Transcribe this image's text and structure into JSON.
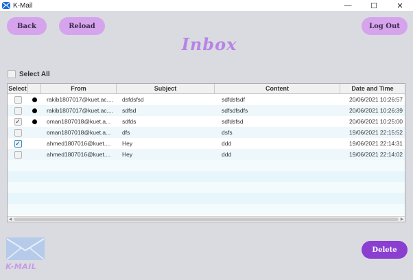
{
  "window": {
    "title": "K-Mail",
    "minimize": "—",
    "maximize": "☐",
    "close": "✕"
  },
  "toolbar": {
    "back_label": "Back",
    "reload_label": "Reload",
    "logout_label": "Log Out"
  },
  "page_title": "Inbox",
  "select_all_label": "Select All",
  "table": {
    "headers": [
      "Select",
      "",
      "From",
      "Subject",
      "Content",
      "Date and Time"
    ],
    "rows": [
      {
        "checked": false,
        "unread": true,
        "from": "rakib1807017@kuet.ac....",
        "subject": "dsfdsfsd",
        "content": "sdfdsfsdf",
        "datetime": "20/06/2021 10:26:57"
      },
      {
        "checked": false,
        "unread": true,
        "from": "rakib1807017@kuet.ac....",
        "subject": "sdfsd",
        "content": "sdfsdfsdfs",
        "datetime": "20/06/2021 10:26:39"
      },
      {
        "checked": true,
        "unread": true,
        "from": "oman1807018@kuet.a...",
        "subject": "sdfds",
        "content": "sdfdsfsd",
        "datetime": "20/06/2021 10:25:00"
      },
      {
        "checked": false,
        "unread": false,
        "from": "oman1807018@kuet.a...",
        "subject": "dfs",
        "content": "dsfs",
        "datetime": "19/06/2021 22:15:52"
      },
      {
        "checked": true,
        "unread": false,
        "from": "ahmed1807016@kuet....",
        "subject": "Hey",
        "content": "ddd",
        "datetime": "19/06/2021 22:14:31"
      },
      {
        "checked": false,
        "unread": false,
        "from": "ahmed1807016@kuet....",
        "subject": "Hey",
        "content": "ddd",
        "datetime": "19/06/2021 22:14:02"
      }
    ]
  },
  "logo_text": "K-MAIL",
  "delete_label": "Delete",
  "colors": {
    "accent": "#d6a4ec",
    "title": "#b784e6",
    "delete": "#8a3fd1"
  },
  "icons": {
    "unread": "unread-dot-icon",
    "check": "✓"
  }
}
